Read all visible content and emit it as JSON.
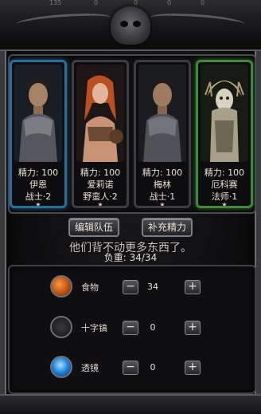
{
  "top_numbers": [
    "135",
    "0",
    "0",
    "0",
    "0"
  ],
  "party": [
    {
      "energy": "精力: 100",
      "name": "伊恩",
      "class": "战士·2",
      "frame": "blue"
    },
    {
      "energy": "精力: 100",
      "name": "爱莉诺",
      "class": "野蛮人·2",
      "frame": "gray"
    },
    {
      "energy": "精力: 100",
      "name": "梅林",
      "class": "战士·1",
      "frame": "gray"
    },
    {
      "energy": "精力: 100",
      "name": "厄科赛",
      "class": "法师·1",
      "frame": "green"
    }
  ],
  "star": "★",
  "buttons": {
    "edit_team": "编辑队伍",
    "refill_energy": "补充精力"
  },
  "toast": "他们背不动更多东西了。",
  "weight": "负重: 34/34",
  "items": [
    {
      "name": "食物",
      "qty": "34",
      "icon": "food-icon"
    },
    {
      "name": "十字镐",
      "qty": "0",
      "icon": "pickaxe-icon"
    },
    {
      "name": "透镜",
      "qty": "0",
      "icon": "lens-icon"
    }
  ],
  "stepper": {
    "minus": "−",
    "plus": "+"
  }
}
